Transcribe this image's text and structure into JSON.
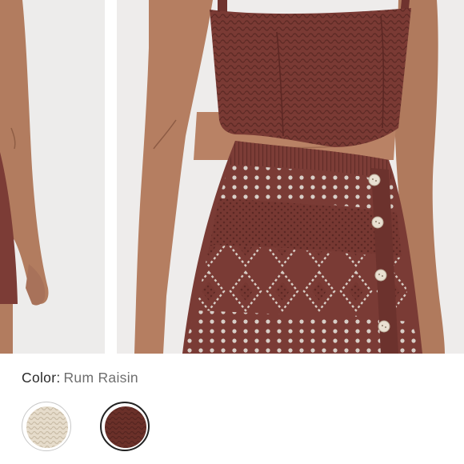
{
  "product": {
    "images": [
      {
        "name": "product-photo-side-view",
        "description_icon": "image-icon"
      },
      {
        "name": "product-photo-front-view",
        "description_icon": "image-icon"
      }
    ]
  },
  "color": {
    "label": "Color:",
    "selected": "Rum Raisin"
  },
  "swatches": [
    {
      "name": "swatch-cream",
      "color": "#e6dccb",
      "selected": false
    },
    {
      "name": "swatch-rum-raisin",
      "color": "#6b3029",
      "selected": true
    }
  ],
  "colors": {
    "knit": "#7a3b35",
    "knit_dark": "#5e2a25",
    "skin": "#b07a5c",
    "background": "#eeeceb",
    "button": "#e9e0d2"
  }
}
